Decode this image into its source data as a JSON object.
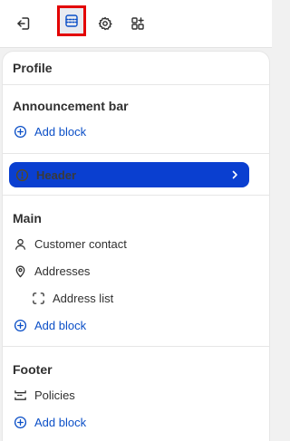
{
  "toolbar": {
    "items": [
      {
        "icon": "exit-icon"
      },
      {
        "icon": "sections-icon",
        "selected": true
      },
      {
        "icon": "gear-icon"
      },
      {
        "icon": "apps-icon"
      }
    ]
  },
  "panel": {
    "title": "Profile",
    "sections": {
      "announcement": {
        "title": "Announcement bar",
        "add_label": "Add block"
      },
      "header": {
        "label": "Header",
        "selected": true
      },
      "main": {
        "title": "Main",
        "items": [
          {
            "label": "Customer contact",
            "icon": "person-icon"
          },
          {
            "label": "Addresses",
            "icon": "location-pin-icon"
          },
          {
            "label": "Address list",
            "icon": "block-frame-icon"
          }
        ],
        "add_label": "Add block"
      },
      "footer": {
        "title": "Footer",
        "items": [
          {
            "label": "Policies",
            "icon": "policies-icon"
          }
        ],
        "add_label": "Add block"
      }
    }
  },
  "colors": {
    "accent": "#0b4fc7",
    "selected_bg": "#0a3fd0",
    "highlight_border": "#e30000"
  }
}
